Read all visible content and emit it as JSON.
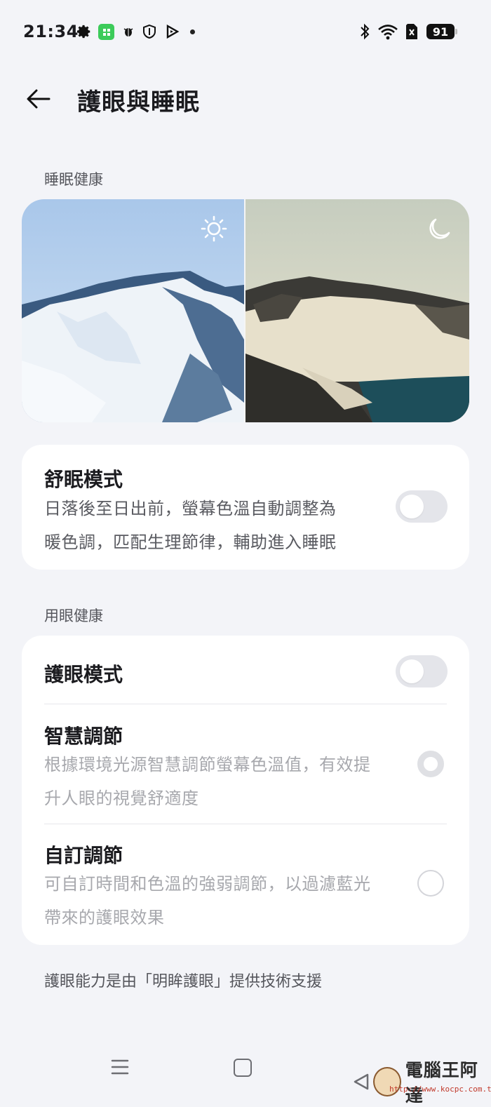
{
  "status_bar": {
    "time": "21:34",
    "battery": "91",
    "icons": [
      "gear-icon",
      "app-icon",
      "bug-icon",
      "shield-icon",
      "play-icon",
      "dot-icon",
      "bluetooth-icon",
      "wifi-icon",
      "sim-icon",
      "battery-icon"
    ]
  },
  "header": {
    "title": "護眼與睡眠"
  },
  "sleep_section": {
    "label": "睡眠健康",
    "preview": {
      "day_icon": "sun-icon",
      "night_icon": "moon-icon"
    },
    "sleep_mode": {
      "title": "舒眠模式",
      "desc_line1": "日落後至日出前，螢幕色溫自動調整為",
      "desc_line2": "暖色調，匹配生理節律，輔助進入睡眠",
      "enabled": false
    }
  },
  "eye_section": {
    "label": "用眼健康",
    "eye_mode": {
      "title": "護眼模式",
      "enabled": false
    },
    "smart": {
      "title": "智慧調節",
      "desc_line1": "根據環境光源智慧調節螢幕色溫值，有效提",
      "desc_line2": "升人眼的視覺舒適度",
      "selected": true
    },
    "custom": {
      "title": "自訂調節",
      "desc_line1": "可自訂時間和色溫的強弱調節，以過濾藍光",
      "desc_line2": "帶來的護眼效果",
      "selected": false
    }
  },
  "footer_note": "護眼能力是由「明眸護眼」提供技術支援",
  "watermark": {
    "text": "電腦王阿達",
    "url": "http://www.kocpc.com.tw"
  },
  "colors": {
    "background": "#f3f4f8",
    "card": "#ffffff",
    "toggle_off": "#e4e5ea"
  }
}
